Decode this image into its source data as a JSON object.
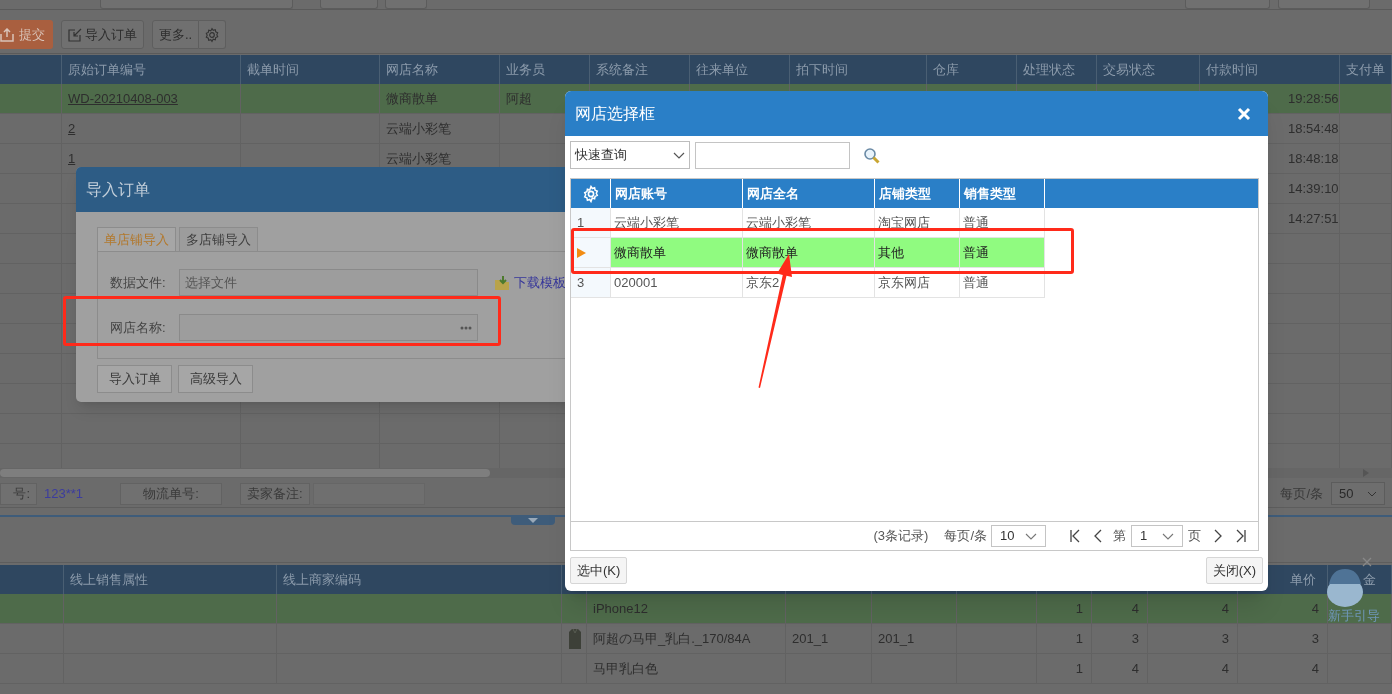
{
  "toolbar": {
    "buttons": [
      {
        "kind": "submit",
        "label": "提交"
      },
      {
        "kind": "import",
        "label": "导入订单"
      },
      {
        "kind": "more",
        "label": "更多.."
      },
      {
        "kind": "settings"
      }
    ]
  },
  "orders_table": {
    "columns": [
      "原始订单编号",
      "截单时间",
      "网店名称",
      "业务员",
      "系统备注",
      "往来单位",
      "拍下时间",
      "仓库",
      "处理状态",
      "交易状态",
      "付款时间",
      "支付单"
    ],
    "rows": [
      {
        "selected": true,
        "order_no": "WD-20210408-003",
        "shop": "微商散单",
        "salesperson": "阿超",
        "paid_time": "19:28:56"
      },
      {
        "selected": false,
        "order_no": "2",
        "shop": "云端小彩笔",
        "paid_time": "18:54:48"
      },
      {
        "selected": false,
        "order_no": "1",
        "shop": "云端小彩笔",
        "paid_time": "18:48:18"
      },
      {
        "selected": false,
        "paid_time": "14:39:10"
      },
      {
        "selected": false,
        "paid_time": "14:27:51"
      }
    ]
  },
  "detail_bar": {
    "fields": [
      {
        "label": "号:",
        "value": "123**1"
      },
      {
        "label": "物流单号:"
      },
      {
        "label": "卖家备注:"
      }
    ],
    "page_size_label": "每页/条",
    "page_size": "50"
  },
  "items_table": {
    "columns": [
      "线上销售属性",
      "线上商家编码",
      "单价",
      "金"
    ],
    "rows": [
      {
        "selected": true,
        "thumbnail": false,
        "name": "iPhone12",
        "qty": "1",
        "column_10": "4",
        "column_11": "4",
        "price": "4"
      },
      {
        "selected": false,
        "thumbnail": true,
        "name": "阿超の马甲_乳白._170/84A",
        "column_6": "201_1",
        "column_7": "201_1",
        "qty": "1",
        "column_10": "3",
        "column_11": "3",
        "price": "3"
      },
      {
        "selected": false,
        "thumbnail": false,
        "name": "马甲乳白色",
        "qty": "1",
        "column_10": "4",
        "column_11": "4",
        "price": "4"
      }
    ]
  },
  "import_dialog": {
    "title": "导入订单",
    "tabs": [
      {
        "label": "单店铺导入",
        "selected": true
      },
      {
        "label": "多店铺导入",
        "selected": false
      }
    ],
    "fields": [
      {
        "kind": "file",
        "label": "数据文件:",
        "placeholder": "选择文件"
      },
      {
        "kind": "picker",
        "label": "网店名称:"
      }
    ],
    "template_link": "下载模板",
    "buttons": [
      "导入订单",
      "高级导入"
    ]
  },
  "shop_picker": {
    "title": "网店选择框",
    "search_mode": "快速查询",
    "columns": [
      "网店账号",
      "网店全名",
      "店铺类型",
      "销售类型"
    ],
    "rows": [
      {
        "index": "1",
        "selected": false,
        "cells": [
          "云端小彩笔",
          "云端小彩笔",
          "淘宝网店",
          "普通"
        ]
      },
      {
        "selected": true,
        "cells": [
          "微商散单",
          "微商散单",
          "其他",
          "普通"
        ]
      },
      {
        "index": "3",
        "selected": false,
        "cells": [
          "020001",
          "京东2",
          "京东网店",
          "普通"
        ]
      }
    ],
    "pager": {
      "total": "(3条记录)",
      "page_size_label": "每页/条",
      "page_size": "10",
      "page_prefix": "第",
      "page": "1",
      "page_suffix": "页"
    },
    "buttons": [
      "选中(K)",
      "关闭(X)"
    ]
  },
  "guide": {
    "label": "新手引导"
  }
}
